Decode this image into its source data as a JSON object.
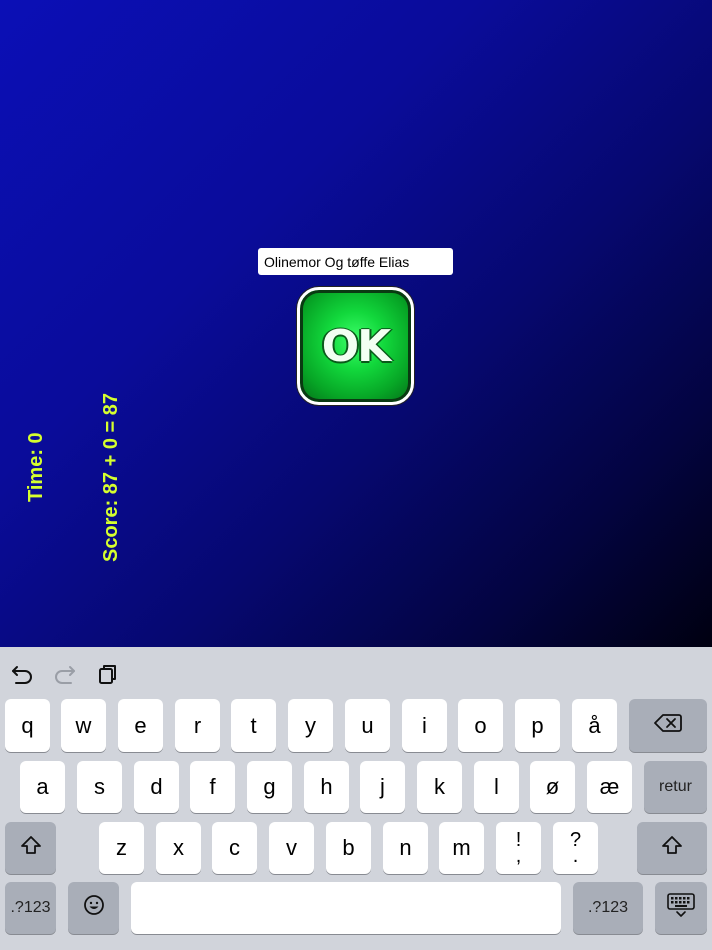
{
  "game": {
    "name_input_value": "Olinemor Og tøffe Elias",
    "ok_label": "OK",
    "time_text": "Time: 0",
    "score_text": "Score: 87 + 0 = 87",
    "colors": {
      "label": "#d6ff2e",
      "ok_green": "#12d83c",
      "background": "#0a0c9a"
    }
  },
  "keyboard": {
    "toolbar_icons": [
      "undo-icon",
      "redo-icon",
      "clipboard-icon"
    ],
    "row1": [
      "q",
      "w",
      "e",
      "r",
      "t",
      "y",
      "u",
      "i",
      "o",
      "p",
      "å"
    ],
    "row2": [
      "a",
      "s",
      "d",
      "f",
      "g",
      "h",
      "j",
      "k",
      "l",
      "ø",
      "æ"
    ],
    "return_label": "retur",
    "row3": [
      "z",
      "x",
      "c",
      "v",
      "b",
      "n",
      "m"
    ],
    "punct1_top": "!",
    "punct1_bottom": ",",
    "punct2_top": "?",
    "punct2_bottom": ".",
    "numbers_label": ".?123",
    "icons": {
      "backspace": "backspace-icon",
      "shift": "shift-icon",
      "emoji": "emoji-icon",
      "dismiss": "keyboard-dismiss-icon"
    }
  }
}
